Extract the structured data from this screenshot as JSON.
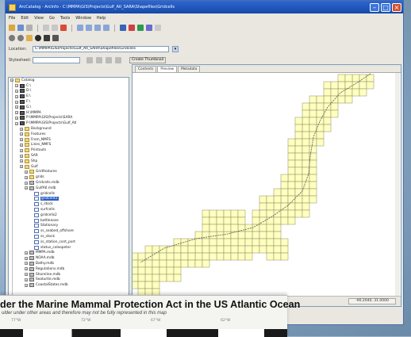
{
  "window": {
    "title": "ArcCatalog - ArcInfo - C:\\MMPA\\GIS\\Projects\\Gulf_Atl_SARA\\Shapefiles\\Gridcells",
    "controls": [
      "minimize",
      "maximize",
      "close"
    ]
  },
  "menu": [
    "File",
    "Edit",
    "View",
    "Go",
    "Tools",
    "Window",
    "Help"
  ],
  "location": {
    "label": "Location:",
    "value": "C:\\MMPA\\GIS\\Projects\\Gulf_Atl_SARA\\Shapefiles\\Gridcells"
  },
  "stylesheet": {
    "label": "Stylesheet:",
    "button": "Create Thumbnail"
  },
  "tree": [
    {
      "label": "Catalog",
      "level": 0,
      "icon": "folder"
    },
    {
      "label": "C:\\",
      "level": 1,
      "icon": "drive"
    },
    {
      "label": "D:\\",
      "level": 1,
      "icon": "drive"
    },
    {
      "label": "E:\\",
      "level": 1,
      "icon": "drive"
    },
    {
      "label": "F:\\",
      "level": 1,
      "icon": "drive"
    },
    {
      "label": "G:\\",
      "level": 1,
      "icon": "drive"
    },
    {
      "label": "H:\\MMPA",
      "level": 1,
      "icon": "drive"
    },
    {
      "label": "P:\\MMPA\\GIS\\Projects\\SARA",
      "level": 1,
      "icon": "drive"
    },
    {
      "label": "P:\\MMPA\\GIS\\Projects\\Gulf_Atl",
      "level": 1,
      "icon": "drive"
    },
    {
      "label": "Background",
      "level": 2,
      "icon": "folder"
    },
    {
      "label": "Features",
      "level": 2,
      "icon": "folder"
    },
    {
      "label": "From_NMFS",
      "level": 2,
      "icon": "folder"
    },
    {
      "label": "Lines_NMFS",
      "level": 2,
      "icon": "folder"
    },
    {
      "label": "Printouts",
      "level": 2,
      "icon": "folder"
    },
    {
      "label": "SAR",
      "level": 2,
      "icon": "folder"
    },
    {
      "label": "Shp",
      "level": 2,
      "icon": "folder"
    },
    {
      "label": "Gulf",
      "level": 2,
      "icon": "folder"
    },
    {
      "label": "Gridfeatures",
      "level": 3,
      "icon": "folder"
    },
    {
      "label": "grids",
      "level": 3,
      "icon": "folder"
    },
    {
      "label": "Gridcells.mdb",
      "level": 3,
      "icon": "gdb"
    },
    {
      "label": "GulfAtl.mdb",
      "level": 3,
      "icon": "gdb"
    },
    {
      "label": "gridcells",
      "level": 4,
      "icon": "table"
    },
    {
      "label": "gridcells1",
      "level": 4,
      "icon": "table",
      "selected": true
    },
    {
      "label": "s_stock",
      "level": 4,
      "icon": "table"
    },
    {
      "label": "surfcells",
      "level": 4,
      "icon": "table"
    },
    {
      "label": "gridcells2",
      "level": 4,
      "icon": "table"
    },
    {
      "label": "bottlenose",
      "level": 4,
      "icon": "table"
    },
    {
      "label": "Stationary",
      "level": 4,
      "icon": "table"
    },
    {
      "label": "ss_seabed_offshore",
      "level": 4,
      "icon": "table"
    },
    {
      "label": "ss_stock",
      "level": 4,
      "icon": "table"
    },
    {
      "label": "ss_station_cont_port",
      "level": 4,
      "icon": "table"
    },
    {
      "label": "status_coleopeter",
      "level": 4,
      "icon": "table"
    },
    {
      "label": "MMPA.mdb",
      "level": 3,
      "icon": "gdb"
    },
    {
      "label": "NOAA.mdb",
      "level": 3,
      "icon": "gdb"
    },
    {
      "label": "Bathy.mdb",
      "level": 3,
      "icon": "gdb"
    },
    {
      "label": "Regulations.mdb",
      "level": 3,
      "icon": "gdb"
    },
    {
      "label": "Shoreline.mdb",
      "level": 3,
      "icon": "gdb"
    },
    {
      "label": "Seaturtle.mdb",
      "level": 3,
      "icon": "gdb"
    },
    {
      "label": "CoastalStates.mdb",
      "level": 3,
      "icon": "gdb"
    }
  ],
  "tabs": [
    {
      "label": "Contents",
      "active": false
    },
    {
      "label": "Preview",
      "active": true
    },
    {
      "label": "Metadata",
      "active": false
    }
  ],
  "status": {
    "value": "-90.2040, 31.0000"
  },
  "overlay": {
    "title": "der the Marine Mammal Protection Act in the US Atlantic Ocean",
    "subtitle": "ulder under other areas and therefore may not be fully represented in this map",
    "axis_labels": [
      "77°W",
      "72°W",
      "67°W",
      "62°W"
    ]
  },
  "colors": {
    "titlebar": "#2f66d1",
    "grid_fill": "#ffffc0",
    "grid_stroke": "#8a8a60",
    "selection": "#2a5dc5"
  }
}
